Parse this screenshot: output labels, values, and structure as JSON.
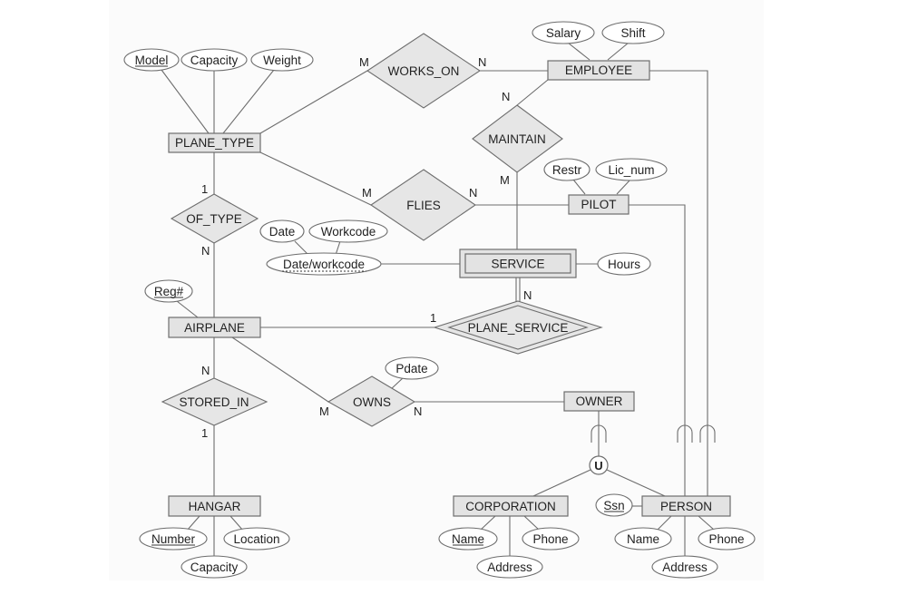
{
  "diagram": {
    "type": "EER diagram",
    "entities": {
      "plane_type": "PLANE_TYPE",
      "employee": "EMPLOYEE",
      "pilot": "PILOT",
      "service": "SERVICE",
      "airplane": "AIRPLANE",
      "hangar": "HANGAR",
      "owner": "OWNER",
      "corporation": "CORPORATION",
      "person": "PERSON"
    },
    "relationships": {
      "works_on": "WORKS_ON",
      "maintain": "MAINTAIN",
      "flies": "FLIES",
      "of_type": "OF_TYPE",
      "plane_service": "PLANE_SERVICE",
      "stored_in": "STORED_IN",
      "owns": "OWNS"
    },
    "attributes": {
      "plane_type_model": "Model",
      "plane_type_capacity": "Capacity",
      "plane_type_weight": "Weight",
      "employee_salary": "Salary",
      "employee_shift": "Shift",
      "pilot_restr": "Restr",
      "pilot_lic_num": "Lic_num",
      "service_date": "Date",
      "service_workcode": "Workcode",
      "service_date_workcode": "Date/workcode",
      "service_hours": "Hours",
      "airplane_reg": "Reg#",
      "owns_pdate": "Pdate",
      "hangar_number": "Number",
      "hangar_location": "Location",
      "hangar_capacity": "Capacity",
      "corporation_name": "Name",
      "corporation_phone": "Phone",
      "corporation_address": "Address",
      "person_ssn": "Ssn",
      "person_name": "Name",
      "person_phone": "Phone",
      "person_address": "Address"
    },
    "cardinalities": {
      "works_on_plane_type": "M",
      "works_on_employee": "N",
      "maintain_employee": "N",
      "maintain_service": "M",
      "flies_plane_type": "M",
      "flies_pilot": "N",
      "of_type_plane_type": "1",
      "of_type_airplane": "N",
      "plane_service_airplane": "1",
      "plane_service_service": "N",
      "stored_in_airplane": "N",
      "stored_in_hangar": "1",
      "owns_airplane": "M",
      "owns_owner": "N"
    },
    "union_symbol": "U"
  }
}
